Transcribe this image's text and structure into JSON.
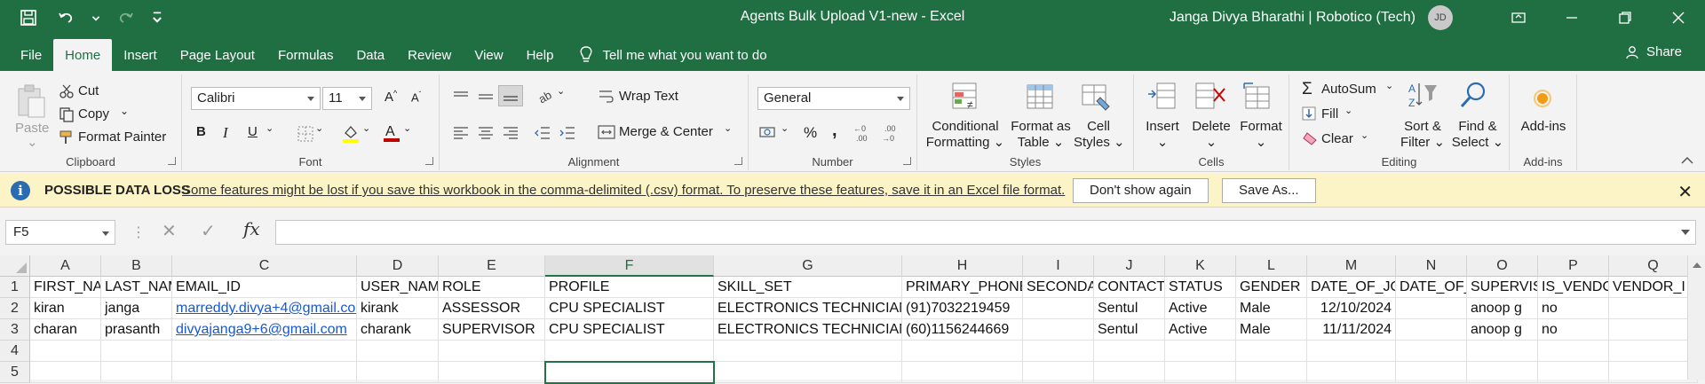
{
  "titlebar": {
    "doc_title": "Agents Bulk Upload V1-new  -  Excel",
    "user": "Janga Divya Bharathi | Robotico (Tech)",
    "avatar_initials": "JD"
  },
  "menu": {
    "tabs": [
      "File",
      "Home",
      "Insert",
      "Page Layout",
      "Formulas",
      "Data",
      "Review",
      "View",
      "Help"
    ],
    "active_tab": "Home",
    "tell_me": "Tell me what you want to do",
    "share": "Share"
  },
  "ribbon": {
    "clipboard": {
      "label": "Clipboard",
      "paste": "Paste",
      "cut": "Cut",
      "copy": "Copy",
      "format_painter": "Format Painter"
    },
    "font": {
      "label": "Font",
      "font_name": "Calibri",
      "font_size": "11",
      "bold": "B",
      "italic": "I",
      "underline": "U"
    },
    "alignment": {
      "label": "Alignment",
      "wrap_text": "Wrap Text",
      "merge_center": "Merge & Center"
    },
    "number": {
      "label": "Number",
      "format": "General"
    },
    "styles": {
      "label": "Styles",
      "conditional_1": "Conditional",
      "conditional_2": "Formatting",
      "format_table_1": "Format as",
      "format_table_2": "Table",
      "cell_styles_1": "Cell",
      "cell_styles_2": "Styles"
    },
    "cells": {
      "label": "Cells",
      "insert": "Insert",
      "delete": "Delete",
      "format": "Format"
    },
    "editing": {
      "label": "Editing",
      "autosum": "AutoSum",
      "fill": "Fill",
      "clear": "Clear",
      "sort_1": "Sort &",
      "sort_2": "Filter",
      "find_1": "Find &",
      "find_2": "Select"
    },
    "addins": {
      "label": "Add-ins",
      "addins": "Add-ins"
    }
  },
  "message_bar": {
    "title": "POSSIBLE DATA LOSS",
    "text": "Some features might be lost if you save this workbook in the comma-delimited (.csv) format. To preserve these features, save it in an Excel file format.",
    "dont_show": "Don't show again",
    "save_as": "Save As..."
  },
  "formula_bar": {
    "name_box": "F5",
    "fx": "fx",
    "formula": ""
  },
  "sheet": {
    "columns": [
      "A",
      "B",
      "C",
      "D",
      "E",
      "F",
      "G",
      "H",
      "I",
      "J",
      "K",
      "L",
      "M",
      "N",
      "O",
      "P",
      "Q"
    ],
    "rows": [
      "1",
      "2",
      "3",
      "4",
      "5"
    ],
    "header_row": [
      "FIRST_NAME",
      "LAST_NAME",
      "EMAIL_ID",
      "USER_NAME",
      "ROLE",
      "PROFILE",
      "SKILL_SET",
      "PRIMARY_PHONE",
      "SECONDARY",
      "CONTACT_",
      "STATUS",
      "GENDER",
      "DATE_OF_JO",
      "DATE_OF_",
      "SUPERVISOR",
      "IS_VENDOR",
      "VENDOR_I"
    ],
    "data_rows": [
      [
        "kiran",
        "janga",
        "marreddy.divya+4@gmail.com",
        "kirank",
        "ASSESSOR",
        "CPU SPECIALIST",
        "ELECTRONICS TECHNICIAN",
        "(91)7032219459",
        "",
        "Sentul",
        "Active",
        "Male",
        "12/10/2024",
        "",
        "anoop g",
        "no",
        ""
      ],
      [
        "charan",
        "prasanth",
        "divyajanga9+6@gmail.com",
        "charank",
        "SUPERVISOR",
        "CPU SPECIALIST",
        "ELECTRONICS TECHNICIAN",
        "(60)1156244669",
        "",
        "Sentul",
        "Active",
        "Male",
        "11/11/2024",
        "",
        "anoop g",
        "no",
        ""
      ]
    ],
    "selected_cell": "F5"
  }
}
